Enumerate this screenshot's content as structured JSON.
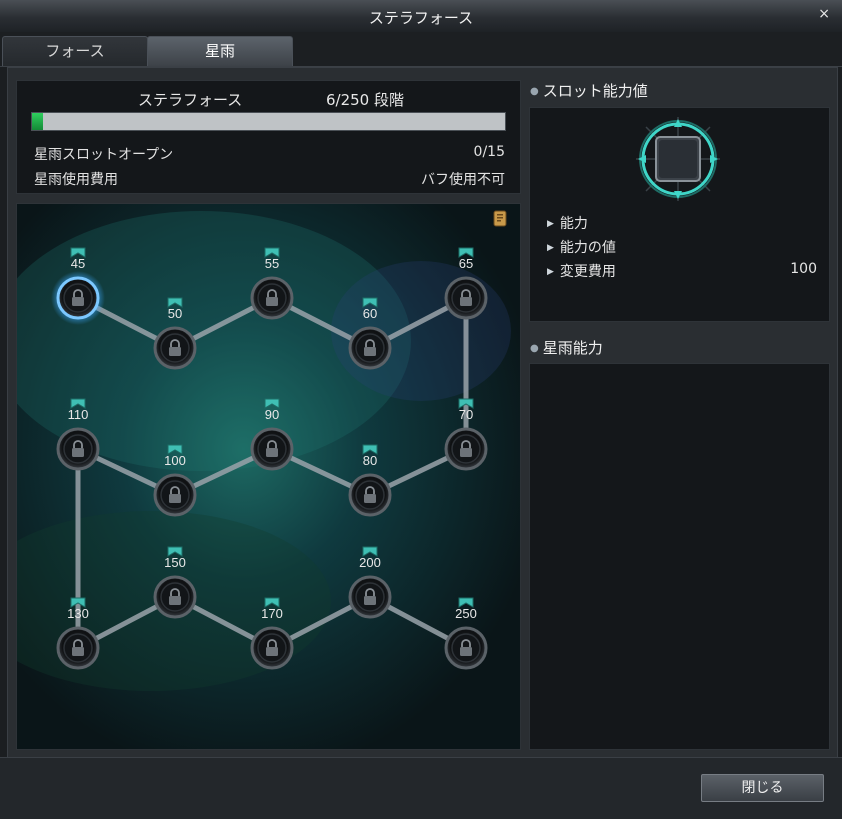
{
  "window": {
    "title": "ステラフォース",
    "close_glyph": "×"
  },
  "tabs": [
    {
      "label": "フォース",
      "active": false
    },
    {
      "label": "星雨",
      "active": true
    }
  ],
  "info": {
    "title": "ステラフォース",
    "stage": "6/250 段階",
    "progress_fraction": 0.024,
    "rows": [
      {
        "label": "星雨スロットオープン",
        "value": "0/15"
      },
      {
        "label": "星雨使用費用",
        "value": "バフ使用不可"
      }
    ]
  },
  "constellation": {
    "nodes": [
      {
        "label": "45",
        "locked": true,
        "highlighted": true
      },
      {
        "label": "50",
        "locked": true
      },
      {
        "label": "55",
        "locked": true
      },
      {
        "label": "60",
        "locked": true
      },
      {
        "label": "65",
        "locked": true
      },
      {
        "label": "70",
        "locked": true
      },
      {
        "label": "80",
        "locked": true
      },
      {
        "label": "90",
        "locked": true
      },
      {
        "label": "100",
        "locked": true
      },
      {
        "label": "110",
        "locked": true
      },
      {
        "label": "130",
        "locked": true
      },
      {
        "label": "150",
        "locked": true
      },
      {
        "label": "170",
        "locked": true
      },
      {
        "label": "200",
        "locked": true
      },
      {
        "label": "250",
        "locked": true
      }
    ],
    "node_icon": "lock-icon",
    "badge_icon": "ribbon-icon"
  },
  "slot_ability": {
    "heading": "スロット能力値",
    "rows": [
      {
        "label": "能力",
        "value": ""
      },
      {
        "label": "能力の値",
        "value": ""
      },
      {
        "label": "変更費用",
        "value": "100"
      }
    ]
  },
  "starrain_ability": {
    "heading": "星雨能力"
  },
  "footer": {
    "close_label": "閉じる"
  },
  "colors": {
    "accent": "#3fd6c8",
    "progress": "#22b04a",
    "highlight": "#5ab8ff"
  }
}
